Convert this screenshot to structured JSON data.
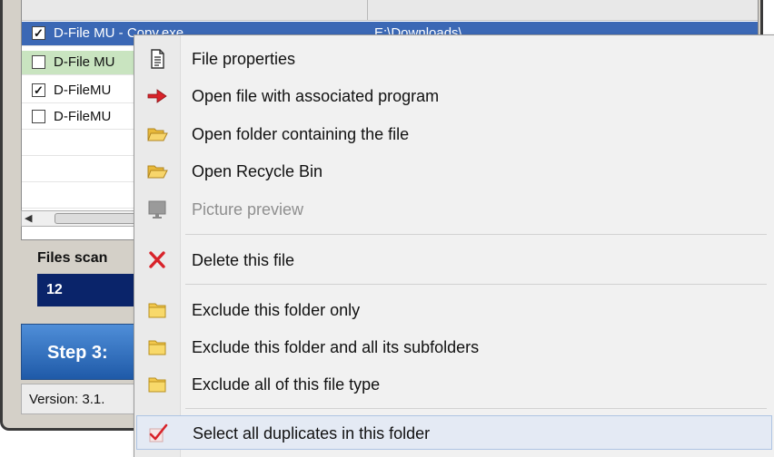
{
  "app": {
    "list_rows": [
      {
        "name": "D-File MU - Copy.exe",
        "path": "E:\\Downloads\\",
        "checked": true,
        "style": "selected"
      },
      {
        "name": "D-File MU",
        "path": "",
        "checked": false,
        "style": "green"
      },
      {
        "name": "D-FileMU",
        "path": "",
        "checked": true,
        "style": "plain"
      },
      {
        "name": "D-FileMU",
        "path": "",
        "checked": false,
        "style": "plain"
      }
    ],
    "files_scanned_label": "Files scan",
    "files_scanned_value": "12",
    "step_button_label": "Step 3:",
    "version_text": "Version: 3.1."
  },
  "context_menu": {
    "items": [
      {
        "label": "File properties",
        "icon": "document-icon",
        "enabled": true
      },
      {
        "label": "Open file with associated program",
        "icon": "red-arrow-icon",
        "enabled": true
      },
      {
        "label": "Open folder containing the file",
        "icon": "open-folder-icon",
        "enabled": true
      },
      {
        "label": "Open Recycle Bin",
        "icon": "open-folder-icon",
        "enabled": true
      },
      {
        "label": "Picture preview",
        "icon": "monitor-icon",
        "enabled": false
      },
      {
        "label": "Delete this file",
        "icon": "red-x-icon",
        "enabled": true
      },
      {
        "label": "Exclude this folder only",
        "icon": "folder-icon",
        "enabled": true
      },
      {
        "label": "Exclude this folder and all its subfolders",
        "icon": "folder-icon",
        "enabled": true
      },
      {
        "label": "Exclude all of this file type",
        "icon": "folder-icon",
        "enabled": true
      },
      {
        "label": "Select all duplicates in this folder",
        "icon": "checkmark-icon",
        "enabled": true,
        "highlighted": true
      }
    ]
  },
  "colors": {
    "selection_blue": "#3b68b5",
    "green_row": "#c9e4c0",
    "step_button": "#2f6fc0",
    "files_count_bg": "#0a246a",
    "menu_bg": "#f1f1f1"
  }
}
